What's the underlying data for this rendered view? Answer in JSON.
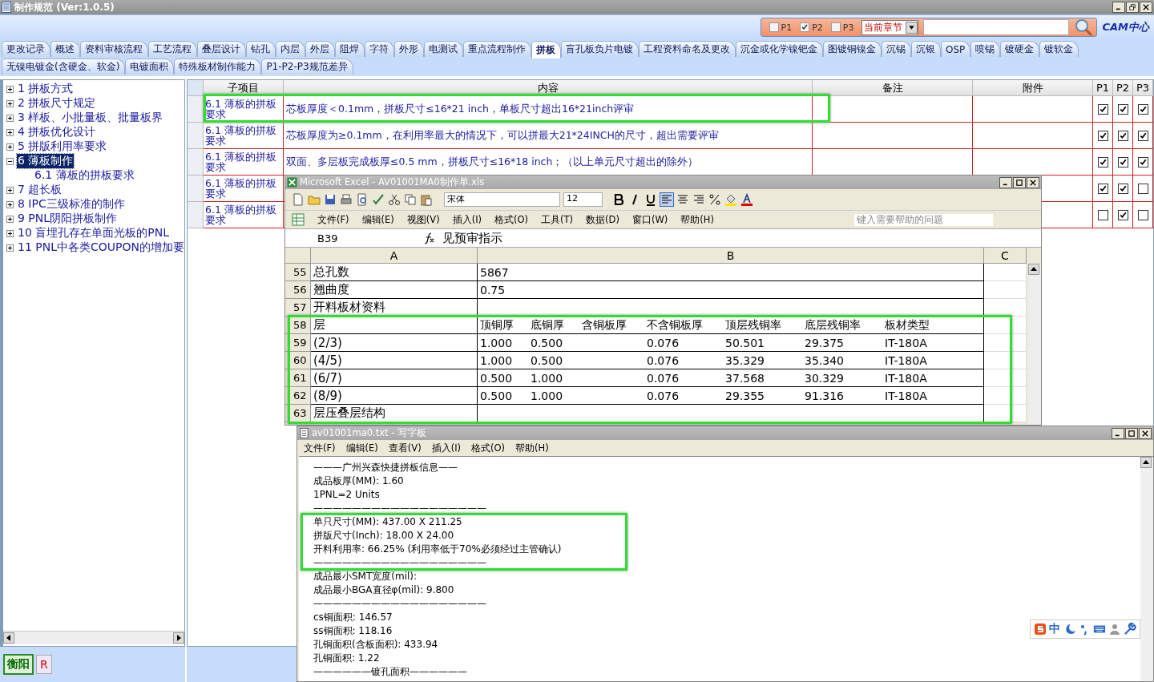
{
  "window": {
    "title": "制作规范 (Ver:1.0.5)"
  },
  "search_bar": {
    "filters": [
      {
        "label": "P1",
        "checked": false
      },
      {
        "label": "P2",
        "checked": true
      },
      {
        "label": "P3",
        "checked": false
      }
    ],
    "scope": "当前章节",
    "logo": "CAM中心"
  },
  "tab_rows": [
    {
      "tabs": [
        {
          "label": "更改记录",
          "selected": false
        },
        {
          "label": "概述",
          "selected": false
        },
        {
          "label": "资料审核流程",
          "selected": false
        },
        {
          "label": "工艺流程",
          "selected": false
        },
        {
          "label": "叠层设计",
          "selected": false
        },
        {
          "label": "钻孔",
          "selected": false
        },
        {
          "label": "内层",
          "selected": false
        },
        {
          "label": "外层",
          "selected": false
        },
        {
          "label": "阻焊",
          "selected": false
        },
        {
          "label": "字符",
          "selected": false
        },
        {
          "label": "外形",
          "selected": false
        },
        {
          "label": "电测试",
          "selected": false
        },
        {
          "label": "重点流程制作",
          "selected": false
        },
        {
          "label": "拼板",
          "selected": true
        },
        {
          "label": "盲孔板负片电镀",
          "selected": false
        },
        {
          "label": "工程资料命名及更改",
          "selected": false
        },
        {
          "label": "沉金或化学镍钯金",
          "selected": false
        },
        {
          "label": "图镀铜镍金",
          "selected": false
        },
        {
          "label": "沉锡",
          "selected": false
        },
        {
          "label": "沉银",
          "selected": false
        },
        {
          "label": "OSP",
          "selected": false
        },
        {
          "label": "喷锡",
          "selected": false
        },
        {
          "label": "镀硬金",
          "selected": false
        },
        {
          "label": "镀软金",
          "selected": false
        }
      ]
    },
    {
      "tabs": [
        {
          "label": "无镍电镀金(含硬金、软金)",
          "selected": false
        },
        {
          "label": "电镀面积",
          "selected": false
        },
        {
          "label": "特殊板材制作能力",
          "selected": false
        },
        {
          "label": "P1-P2-P3规范差异",
          "selected": false
        }
      ]
    }
  ],
  "tree": [
    {
      "label": "1 拼板方式",
      "expanded": false,
      "selected": false
    },
    {
      "label": "2 拼板尺寸规定",
      "expanded": false,
      "selected": false
    },
    {
      "label": "3 样板、小批量板、批量板界",
      "expanded": false,
      "selected": false
    },
    {
      "label": "4 拼板优化设计",
      "expanded": false,
      "selected": false
    },
    {
      "label": "5 拼版利用率要求",
      "expanded": false,
      "selected": false
    },
    {
      "label": "6 薄板制作",
      "expanded": true,
      "selected": true,
      "children": [
        {
          "label": "6.1 薄板的拼板要求",
          "selected": false
        }
      ]
    },
    {
      "label": "7 超长板",
      "expanded": false,
      "selected": false
    },
    {
      "label": "8 IPC三级标准的制作",
      "expanded": false,
      "selected": false
    },
    {
      "label": "9 PNL阴阳拼板制作",
      "expanded": false,
      "selected": false
    },
    {
      "label": "10 盲埋孔存在单面光板的PNL",
      "expanded": false,
      "selected": false
    },
    {
      "label": "11 PNL中各类COUPON的增加要",
      "expanded": false,
      "selected": false
    }
  ],
  "status": {
    "city": "衡阳",
    "flag": "R"
  },
  "table": {
    "columns": [
      "子项目",
      "内容",
      "备注",
      "附件",
      "P1",
      "P2",
      "P3"
    ],
    "rows": [
      {
        "sub_item": "6.1 薄板的拼板要求",
        "content": "芯板厚度＜0.1mm，拼板尺寸≤16*21 inch，单板尺寸超出16*21inch评审",
        "p1": true,
        "p2": true,
        "p3": true
      },
      {
        "sub_item": "6.1 薄板的拼板要求",
        "content": "芯板厚度为≥0.1mm，在利用率最大的情况下，可以拼最大21*24INCH的尺寸，超出需要评审",
        "p1": true,
        "p2": true,
        "p3": true
      },
      {
        "sub_item": "6.1 薄板的拼板要求",
        "content": "双面、多层板完成板厚≤0.5 mm，拼板尺寸≤16*18 inch；（以上单元尺寸超出的除外）",
        "p1": true,
        "p2": true,
        "p3": true
      },
      {
        "sub_item": "6.1 薄板的拼板要求",
        "p1": true,
        "p2": true,
        "p3": false
      },
      {
        "sub_item": "6.1 薄板的拼板要求",
        "p1": false,
        "p2": true,
        "p3": false
      }
    ]
  },
  "excel": {
    "title": "Microsoft Excel - AV01001MA0制作单.xls",
    "font": "宋体",
    "font_size": "12",
    "menu": [
      "文件(F)",
      "编辑(E)",
      "视图(V)",
      "插入(I)",
      "格式(O)",
      "工具(T)",
      "数据(D)",
      "窗口(W)",
      "帮助(H)"
    ],
    "help_placeholder": "键入需要帮助的问题",
    "cell": "B39",
    "formula": "见预审指示",
    "columns": [
      "A",
      "B",
      "C"
    ],
    "rows": [
      {
        "num": "55",
        "a": "总孔数",
        "kind": "text",
        "b": [
          "5867"
        ]
      },
      {
        "num": "56",
        "a": "翘曲度",
        "kind": "text",
        "b": [
          "0.75"
        ]
      },
      {
        "num": "57",
        "a": "开料板材资料",
        "kind": "text",
        "b": []
      },
      {
        "num": "58",
        "a": "层",
        "kind": "header",
        "b": [
          "顶铜厚",
          "底铜厚",
          "含铜板厚",
          "不含铜板厚",
          "顶层残铜率",
          "底层残铜率",
          "板材类型"
        ]
      },
      {
        "num": "59",
        "a": "(2/3)",
        "kind": "values",
        "b": [
          "1.000",
          "0.500",
          "0.076",
          "50.501",
          "29.375",
          "IT-180A"
        ]
      },
      {
        "num": "60",
        "a": "(4/5)",
        "kind": "values",
        "b": [
          "1.000",
          "0.500",
          "0.076",
          "35.329",
          "35.340",
          "IT-180A"
        ]
      },
      {
        "num": "61",
        "a": "(6/7)",
        "kind": "values",
        "b": [
          "0.500",
          "1.000",
          "0.076",
          "37.568",
          "30.329",
          "IT-180A"
        ]
      },
      {
        "num": "62",
        "a": "(8/9)",
        "kind": "values",
        "b": [
          "0.500",
          "1.000",
          "0.076",
          "29.355",
          "91.316",
          "IT-180A"
        ]
      },
      {
        "num": "63",
        "a": "层压叠层结构",
        "kind": "text",
        "b": []
      }
    ]
  },
  "notepad": {
    "title": "av01001ma0.txt - 写字板",
    "menu": [
      "文件(F)",
      "编辑(E)",
      "查看(V)",
      "插入(I)",
      "格式(O)",
      "帮助(H)"
    ],
    "lines": [
      "———广州兴森快捷拼板信息——",
      "成品板厚(MM): 1.60",
      "1PNL=2 Units",
      "——————————————————",
      "单只尺寸(MM): 437.00 X 211.25",
      "拼版尺寸(Inch): 18.00 X 24.00",
      "开料利用率: 66.25% (利用率低于70%必须经过主管确认)",
      "——————————————————",
      "成品最小SMT宽度(mil):",
      "成品最小BGA直径φ(mil): 9.800",
      "——————————————————",
      "cs铜面积: 146.57",
      "ss铜面积: 118.16",
      "孔铜面积(含板面积): 433.94",
      "孔铜面积: 1.22",
      "——————镀孔面积——————"
    ]
  },
  "ime": {
    "label": "中"
  }
}
